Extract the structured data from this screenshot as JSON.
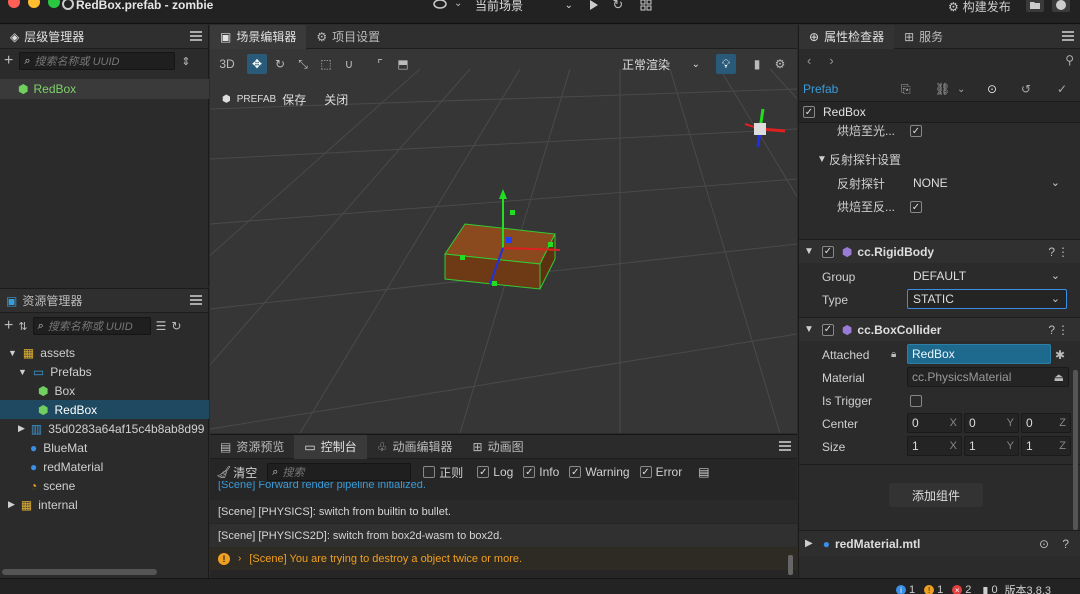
{
  "window": {
    "title": "RedBox.prefab - zombie",
    "scene_select": "当前场景",
    "publish": "构建发布"
  },
  "hierarchy": {
    "tab": "层级管理器",
    "search_placeholder": "搜索名称或 UUID",
    "node": "RedBox"
  },
  "assets": {
    "tab": "资源管理器",
    "search_placeholder": "搜索名称或 UUID",
    "items": [
      {
        "label": "assets"
      },
      {
        "label": "Prefabs"
      },
      {
        "label": "Box"
      },
      {
        "label": "RedBox"
      },
      {
        "label": "35d0283a64af15c4b8ab8d99"
      },
      {
        "label": "BlueMat"
      },
      {
        "label": "redMaterial"
      },
      {
        "label": "scene"
      },
      {
        "label": "internal"
      }
    ]
  },
  "scene": {
    "tabs": [
      "场景编辑器",
      "项目设置"
    ],
    "mode_3d": "3D",
    "render_mode": "正常渲染",
    "prefab_tag": "PREFAB",
    "save": "保存",
    "close": "关闭"
  },
  "console": {
    "tabs": [
      "资源预览",
      "控制台",
      "动画编辑器",
      "动画图"
    ],
    "clear": "清空",
    "search_placeholder": "搜索",
    "filters": {
      "regex": "正则",
      "log": "Log",
      "info": "Info",
      "warning": "Warning",
      "error": "Error"
    },
    "logs": [
      "[Scene] Forward render pipeline initialized.",
      "[Scene] [PHYSICS]: switch from builtin to bullet.",
      "[Scene] [PHYSICS2D]: switch from box2d-wasm to box2d.",
      "[Scene] You are trying to destroy a object twice or more."
    ]
  },
  "inspector": {
    "tabs": [
      "属性检查器",
      "服务"
    ],
    "prefab_label": "Prefab",
    "node_name": "RedBox",
    "bake_light": "烘焙至光...",
    "reflection_section": "反射探针设置",
    "reflection_probe_label": "反射探针",
    "reflection_probe_value": "NONE",
    "bake_reflection": "烘焙至反...",
    "rigidbody": {
      "name": "cc.RigidBody",
      "group_label": "Group",
      "group_value": "DEFAULT",
      "type_label": "Type",
      "type_value": "STATIC"
    },
    "boxcollider": {
      "name": "cc.BoxCollider",
      "attached_label": "Attached",
      "attached_value": "RedBox",
      "material_label": "Material",
      "material_value": "cc.PhysicsMaterial",
      "trigger_label": "Is Trigger",
      "center_label": "Center",
      "center": [
        "0",
        "0",
        "0"
      ],
      "size_label": "Size",
      "size": [
        "1",
        "1",
        "1"
      ],
      "axes": [
        "X",
        "Y",
        "Z"
      ]
    },
    "add_component": "添加组件",
    "material_asset": "redMaterial.mtl"
  },
  "status": {
    "info_count": "1",
    "warn_count": "1",
    "error_count": "2",
    "other_count": "0",
    "version": "版本3.8.3"
  },
  "colors": {
    "accent": "#2a5a79",
    "selection": "#1e4960",
    "warning": "#f0a020",
    "error": "#e04040",
    "info": "#3a8ee6",
    "box": "#8a4a1e",
    "gizmo_green": "#22dd22"
  }
}
